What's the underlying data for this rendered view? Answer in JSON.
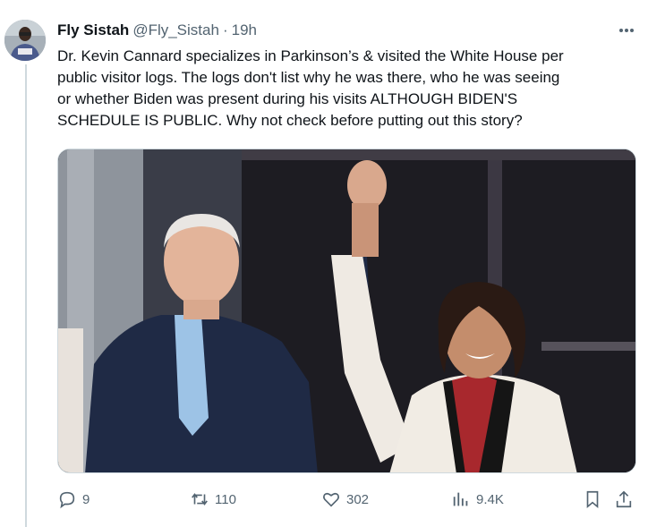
{
  "tweet": {
    "display_name": "Fly Sistah",
    "handle": "@Fly_Sistah",
    "separator": "·",
    "time": "19h",
    "text_lines": [
      "Dr. Kevin Cannard specializes in Parkinson’s & visited the White House per",
      "public visitor logs. The logs don't list why he was there, who he was seeing",
      "or whether Biden was present during his visits ALTHOUGH BIDEN'S",
      "SCHEDULE IS PUBLIC. Why not check before putting out this story?"
    ],
    "avatar_shirt_text": "",
    "media_description_icon": "photo"
  },
  "actions": {
    "replies": "9",
    "retweets": "110",
    "likes": "302",
    "views": "9.4K"
  },
  "icons": {
    "reply": "reply-icon",
    "retweet": "retweet-icon",
    "like": "heart-icon",
    "views": "views-chart-icon",
    "bookmark": "bookmark-icon",
    "share": "share-icon",
    "more": "more-dots-icon"
  },
  "colors": {
    "text": "#0f1419",
    "secondary": "#536471",
    "border": "#cfd9de"
  }
}
